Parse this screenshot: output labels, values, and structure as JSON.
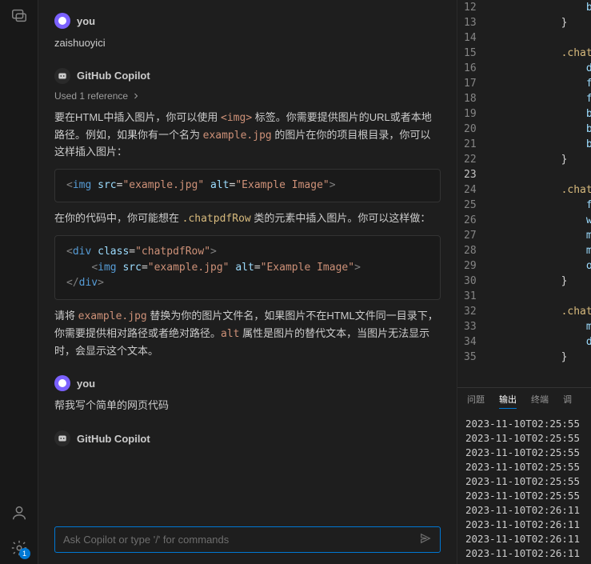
{
  "chat": {
    "messages": [
      {
        "author": "you",
        "body": "zaishuoyici"
      },
      {
        "author": "GitHub Copilot",
        "used_ref": "Used 1 reference",
        "p1_a": "要在HTML中插入图片，你可以使用 ",
        "p1_code": "<img>",
        "p1_b": " 标签。你需要提供图片的URL或者本地路径。例如，如果你有一个名为 ",
        "p1_code2": "example.jpg",
        "p1_c": " 的图片在你的项目根目录，你可以这样插入图片：",
        "code1": "<img src=\"example.jpg\" alt=\"Example Image\">",
        "p2_a": "在你的代码中，你可能想在 ",
        "p2_sel": ".chatpdfRow",
        "p2_b": " 类的元素中插入图片。你可以这样做：",
        "code2": "<div class=\"chatpdfRow\">\n    <img src=\"example.jpg\" alt=\"Example Image\">\n</div>",
        "p3_a": "请将 ",
        "p3_code": "example.jpg",
        "p3_b": " 替换为你的图片文件名，如果图片不在HTML文件同一目录下，你需要提供相对路径或者绝对路径。",
        "p3_code2": "alt",
        "p3_c": " 属性是图片的替代文本，当图片无法显示时，会显示这个文本。"
      },
      {
        "author": "you",
        "body": "帮我写个简单的网页代码"
      },
      {
        "author": "GitHub Copilot"
      }
    ],
    "input_placeholder": "Ask Copilot or type '/' for commands"
  },
  "editor": {
    "lines": [
      {
        "n": 12,
        "indent": 4,
        "sel": "",
        "prop": "backg"
      },
      {
        "n": 13,
        "indent": 3,
        "brace": "}"
      },
      {
        "n": 14,
        "indent": 0,
        "blank": true
      },
      {
        "n": 15,
        "indent": 3,
        "sel": ".chatpdfB"
      },
      {
        "n": 16,
        "indent": 4,
        "prop": "displ"
      },
      {
        "n": 17,
        "indent": 4,
        "prop": "flex-"
      },
      {
        "n": 18,
        "indent": 4,
        "prop": "flex:"
      },
      {
        "n": 19,
        "indent": 4,
        "prop": "backg"
      },
      {
        "n": 20,
        "indent": 4,
        "prop": "backg"
      },
      {
        "n": 21,
        "indent": 4,
        "prop": "backg"
      },
      {
        "n": 22,
        "indent": 3,
        "brace": "}"
      },
      {
        "n": 23,
        "indent": 0,
        "blank": true,
        "current": true
      },
      {
        "n": 24,
        "indent": 3,
        "sel": ".chatpdfL"
      },
      {
        "n": 25,
        "indent": 4,
        "prop": "flex:"
      },
      {
        "n": 26,
        "indent": 4,
        "prop": "width"
      },
      {
        "n": 27,
        "indent": 4,
        "prop": "max-w"
      },
      {
        "n": 28,
        "indent": 4,
        "prop": "margi"
      },
      {
        "n": 29,
        "indent": 4,
        "prop": "overf"
      },
      {
        "n": 30,
        "indent": 3,
        "brace": "}"
      },
      {
        "n": 31,
        "indent": 0,
        "blank": true
      },
      {
        "n": 32,
        "indent": 3,
        "sel": ".chatpdfR"
      },
      {
        "n": 33,
        "indent": 4,
        "prop": "margi"
      },
      {
        "n": 34,
        "indent": 4,
        "prop": "displ"
      },
      {
        "n": 35,
        "indent": 3,
        "brace": "}"
      }
    ]
  },
  "terminal": {
    "tabs": [
      "问题",
      "输出",
      "终端",
      "调"
    ],
    "active_tab": 1,
    "lines": [
      "2023-11-10T02:25:55",
      "2023-11-10T02:25:55",
      "2023-11-10T02:25:55",
      "2023-11-10T02:25:55",
      "2023-11-10T02:25:55",
      "2023-11-10T02:25:55",
      "2023-11-10T02:26:11",
      "2023-11-10T02:26:11",
      "2023-11-10T02:26:11",
      "2023-11-10T02:26:11"
    ]
  },
  "settings_badge": "1"
}
